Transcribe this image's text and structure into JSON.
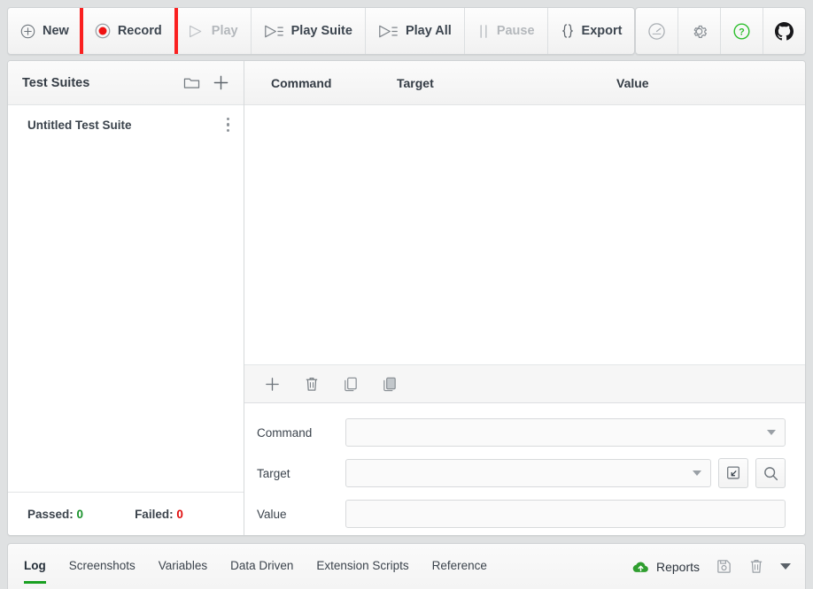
{
  "toolbar": {
    "buttons": [
      {
        "label": "New",
        "icon": "plus-circle-icon",
        "disabled": false,
        "highlighted": false
      },
      {
        "label": "Record",
        "icon": "record-icon",
        "disabled": false,
        "highlighted": true
      },
      {
        "label": "Play",
        "icon": "play-icon",
        "disabled": true,
        "highlighted": false
      },
      {
        "label": "Play Suite",
        "icon": "play-suite-icon",
        "disabled": false,
        "highlighted": false
      },
      {
        "label": "Play All",
        "icon": "play-all-icon",
        "disabled": false,
        "highlighted": false
      },
      {
        "label": "Pause",
        "icon": "pause-icon",
        "disabled": true,
        "highlighted": false
      },
      {
        "label": "Export",
        "icon": "braces-icon",
        "disabled": false,
        "highlighted": false
      }
    ],
    "icon_buttons": [
      {
        "name": "speed-gauge-icon",
        "label": ""
      },
      {
        "name": "gear-icon",
        "label": ""
      },
      {
        "name": "help-icon",
        "label": ""
      },
      {
        "name": "github-icon",
        "label": ""
      }
    ],
    "highlight_color": "#fa2020"
  },
  "sidebar": {
    "title": "Test Suites",
    "actions": [
      {
        "name": "new-folder-icon"
      },
      {
        "name": "add-icon"
      }
    ],
    "suites": [
      {
        "name": "Untitled Test Suite"
      }
    ],
    "footer": {
      "passed_label": "Passed:",
      "passed_count": "0",
      "failed_label": "Failed:",
      "failed_count": "0",
      "passed_color": "#17912a",
      "failed_color": "#e00c0c"
    }
  },
  "table": {
    "columns": [
      "Command",
      "Target",
      "Value"
    ],
    "rows": []
  },
  "row_actions": [
    {
      "name": "add-command-icon"
    },
    {
      "name": "delete-command-icon"
    },
    {
      "name": "copy-command-icon"
    },
    {
      "name": "paste-command-icon"
    }
  ],
  "form": {
    "command": {
      "label": "Command",
      "value": "",
      "placeholder": ""
    },
    "target": {
      "label": "Target",
      "value": "",
      "placeholder": ""
    },
    "value": {
      "label": "Value",
      "value": "",
      "placeholder": ""
    },
    "target_buttons": [
      {
        "name": "select-element-icon"
      },
      {
        "name": "find-element-icon"
      }
    ]
  },
  "bottom": {
    "tabs": [
      {
        "label": "Log",
        "active": true
      },
      {
        "label": "Screenshots",
        "active": false
      },
      {
        "label": "Variables",
        "active": false
      },
      {
        "label": "Data Driven",
        "active": false
      },
      {
        "label": "Extension Scripts",
        "active": false
      },
      {
        "label": "Reference",
        "active": false
      }
    ],
    "active_underline_color": "#19a021",
    "reports": {
      "label": "Reports",
      "icon": "cloud-upload-icon",
      "icon_color": "#2f9e2f"
    },
    "actions": [
      {
        "name": "save-log-icon"
      },
      {
        "name": "clear-log-icon"
      },
      {
        "name": "collapse-chevron-icon"
      }
    ]
  }
}
